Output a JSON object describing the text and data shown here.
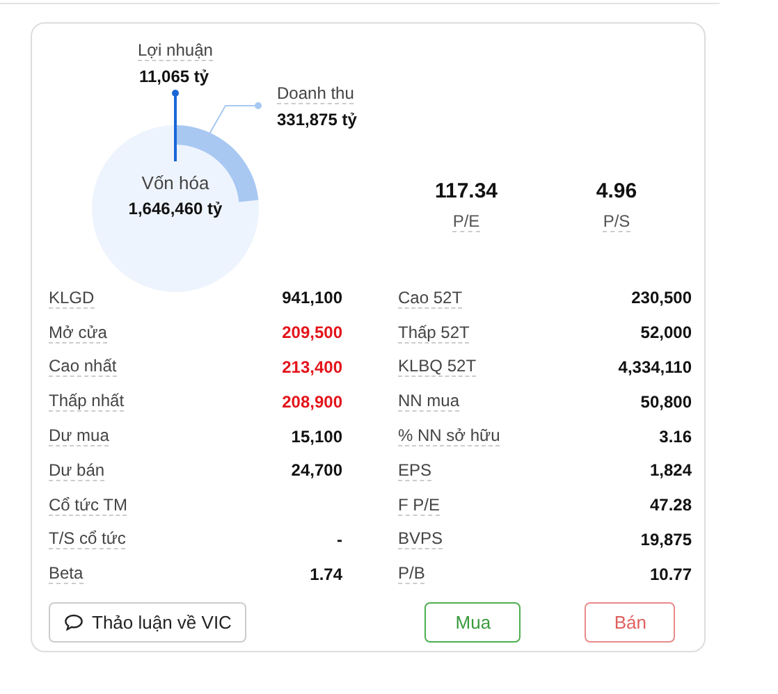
{
  "chart": {
    "profit": {
      "label": "Lợi nhuận",
      "value": "11,065 tỷ"
    },
    "revenue": {
      "label": "Doanh thu",
      "value": "331,875 tỷ"
    },
    "market_cap": {
      "label": "Vốn hóa",
      "value": "1,646,460 tỷ"
    }
  },
  "ratios": [
    {
      "value": "117.34",
      "label": "P/E"
    },
    {
      "value": "4.96",
      "label": "P/S"
    }
  ],
  "left_rows": [
    {
      "label": "KLGD",
      "value": "941,100"
    },
    {
      "label": "Mở cửa",
      "value": "209,500",
      "color": "#e3141b"
    },
    {
      "label": "Cao nhất",
      "value": "213,400",
      "color": "#e3141b"
    },
    {
      "label": "Thấp nhất",
      "value": "208,900",
      "color": "#e3141b"
    },
    {
      "label": "Dư mua",
      "value": "15,100"
    },
    {
      "label": "Dư bán",
      "value": "24,700"
    },
    {
      "label": "Cổ tức TM"
    },
    {
      "label": "T/S cổ tức",
      "value": "-"
    },
    {
      "label": "Beta",
      "value": "1.74"
    }
  ],
  "right_rows": [
    {
      "label": "Cao 52T",
      "value": "230,500"
    },
    {
      "label": "Thấp 52T",
      "value": "52,000"
    },
    {
      "label": "KLBQ 52T",
      "value": "4,334,110"
    },
    {
      "label": "NN mua",
      "value": "50,800"
    },
    {
      "label": "% NN sở hữu",
      "value": "3.16"
    },
    {
      "label": "EPS",
      "value": "1,824"
    },
    {
      "label": "F P/E",
      "value": "47.28"
    },
    {
      "label": "BVPS",
      "value": "19,875"
    },
    {
      "label": "P/B",
      "value": "10.77"
    }
  ],
  "discuss_button": "Thảo luận về VIC",
  "buy_button": "Mua",
  "sell_button": "Bán"
}
